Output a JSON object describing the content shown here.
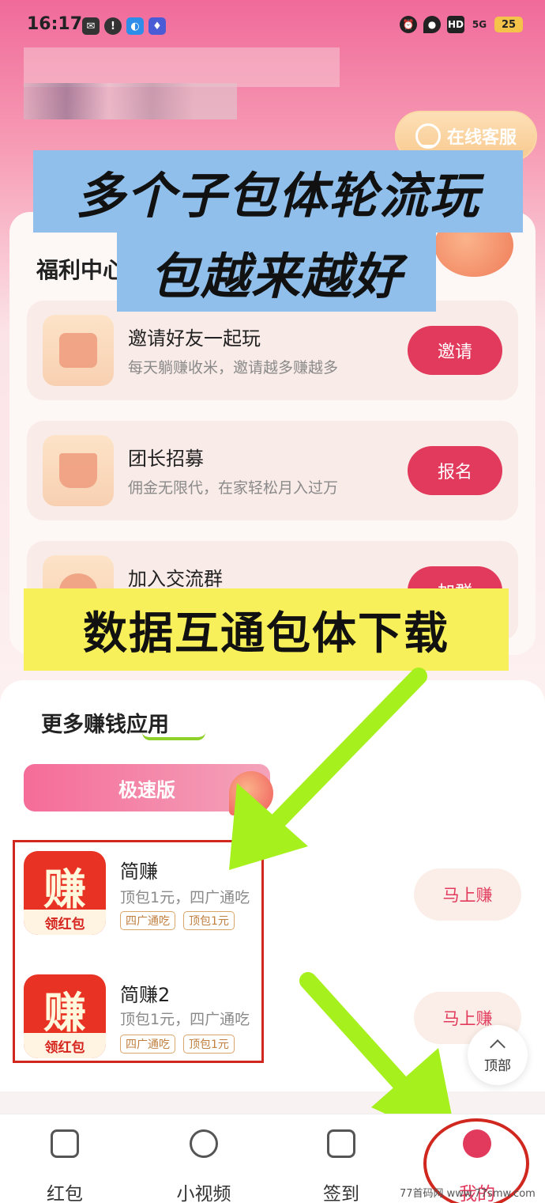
{
  "status_bar": {
    "time": "16:17",
    "network": "5G",
    "hd": "HD",
    "battery": "25"
  },
  "header": {
    "service_label": "在线客服"
  },
  "banners": {
    "line1": "多个子包体轮流玩",
    "line2": "包越来越好",
    "line3": "数据互通包体下载"
  },
  "welfare": {
    "title": "福利中心",
    "tasks": [
      {
        "title": "邀请好友一起玩",
        "desc": "每天躺赚收米，邀请越多赚越多",
        "button": "邀请"
      },
      {
        "title": "团长招募",
        "desc": "佣金无限代，在家轻松月入过万",
        "button": "报名"
      },
      {
        "title": "加入交流群",
        "desc": "",
        "button": "加群"
      }
    ]
  },
  "apps": {
    "title": "更多赚钱应用",
    "tab": "极速版",
    "items": [
      {
        "icon_glyph": "赚",
        "icon_band": "领红包",
        "name": "简赚",
        "desc": "顶包1元，四广通吃",
        "tags": [
          "四广通吃",
          "顶包1元"
        ],
        "button": "马上赚"
      },
      {
        "icon_glyph": "赚",
        "icon_band": "领红包",
        "name": "简赚2",
        "desc": "顶包1元，四广通吃",
        "tags": [
          "四广通吃",
          "顶包1元"
        ],
        "button": "马上赚"
      }
    ],
    "top_button": "顶部"
  },
  "nav": {
    "items": [
      {
        "label": "红包",
        "icon": "red-packet-icon"
      },
      {
        "label": "小视频",
        "icon": "play-icon"
      },
      {
        "label": "签到",
        "icon": "checkin-icon"
      },
      {
        "label": "我的",
        "icon": "profile-icon"
      }
    ]
  },
  "watermark": "77首码网 www.77smw.com",
  "colors": {
    "accent": "#e23a5c",
    "highlight_red": "#d0271f",
    "arrow_green": "#a6f01e",
    "banner_blue": "#8fbfea",
    "banner_yellow": "#f7f05a"
  }
}
